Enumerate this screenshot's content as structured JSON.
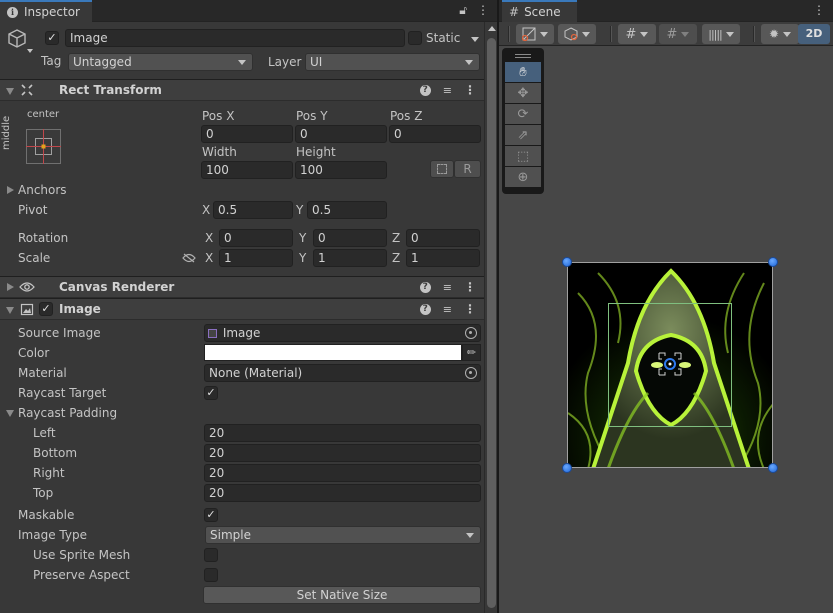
{
  "inspector": {
    "tab_label": "Inspector",
    "object": {
      "active": true,
      "name": "Image",
      "static_label": "Static",
      "static": false,
      "tag_label": "Tag",
      "tag_value": "Untagged",
      "layer_label": "Layer",
      "layer_value": "UI"
    },
    "rect_transform": {
      "title": "Rect Transform",
      "anchor_h": "center",
      "anchor_v": "middle",
      "pos_x_label": "Pos X",
      "pos_y_label": "Pos Y",
      "pos_z_label": "Pos Z",
      "pos_x": "0",
      "pos_y": "0",
      "pos_z": "0",
      "width_label": "Width",
      "height_label": "Height",
      "width": "100",
      "height": "100",
      "raw_edit_label": "R",
      "anchors_label": "Anchors",
      "pivot_label": "Pivot",
      "pivot_x": "0.5",
      "pivot_y": "0.5",
      "rotation_label": "Rotation",
      "rot_x": "0",
      "rot_y": "0",
      "rot_z": "0",
      "scale_label": "Scale",
      "scale_x": "1",
      "scale_y": "1",
      "scale_z": "1",
      "x": "X",
      "y": "Y",
      "z": "Z"
    },
    "canvas_renderer": {
      "title": "Canvas Renderer"
    },
    "image": {
      "title": "Image",
      "enabled": true,
      "source_image_label": "Source Image",
      "source_image_value": "Image",
      "color_label": "Color",
      "color_value": "#ffffff",
      "material_label": "Material",
      "material_value": "None (Material)",
      "raycast_target_label": "Raycast Target",
      "raycast_target": true,
      "raycast_padding_label": "Raycast Padding",
      "left_label": "Left",
      "left": "20",
      "bottom_label": "Bottom",
      "bottom": "20",
      "right_label": "Right",
      "right": "20",
      "top_label": "Top",
      "top": "20",
      "maskable_label": "Maskable",
      "maskable": true,
      "image_type_label": "Image Type",
      "image_type_value": "Simple",
      "use_sprite_mesh_label": "Use Sprite Mesh",
      "use_sprite_mesh": false,
      "preserve_aspect_label": "Preserve Aspect",
      "preserve_aspect": false,
      "set_native_size_label": "Set Native Size"
    }
  },
  "scene": {
    "tab_label": "Scene",
    "mode_2d_label": "2D",
    "tools": [
      "hand-tool",
      "move-tool",
      "rotate-tool",
      "scale-tool",
      "rect-tool",
      "transform-tool"
    ],
    "active_tool": "hand-tool",
    "accent": "#46607c"
  }
}
